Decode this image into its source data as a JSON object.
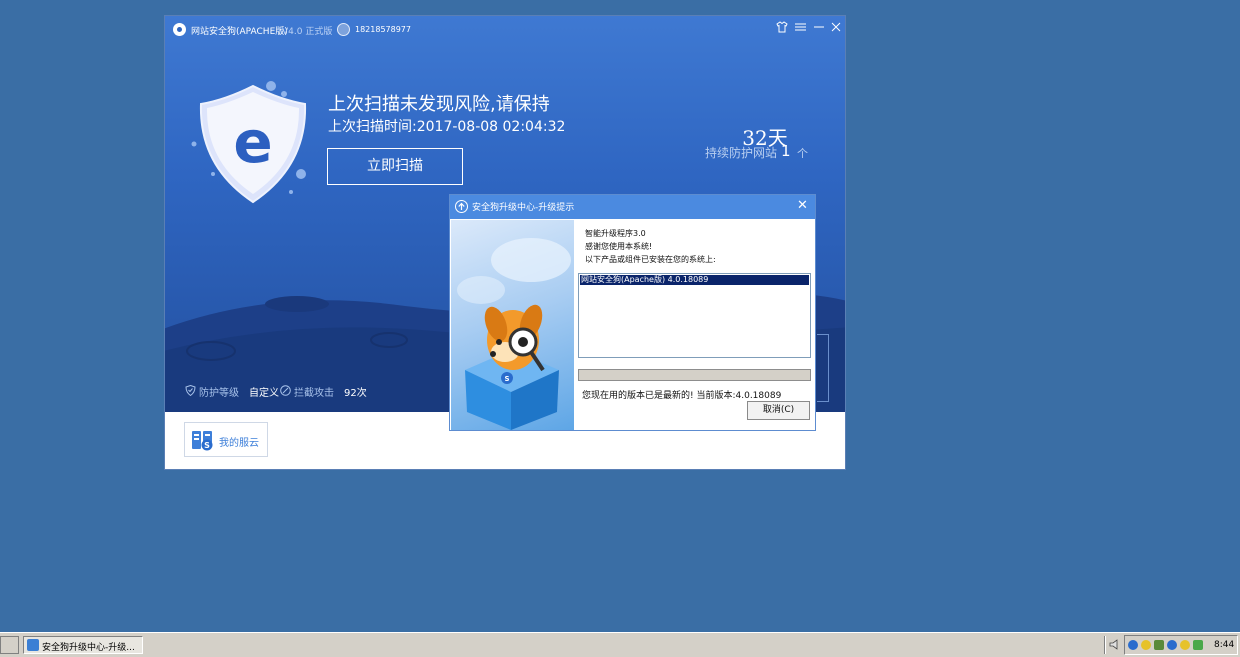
{
  "main_window": {
    "app_name": "网站安全狗(APACHE版)",
    "version": "V4.0 正式版",
    "user_phone": "18218578977",
    "controls": {
      "skin": "skin-icon",
      "menu": "menu-icon",
      "minimize": "minimize-icon",
      "close": "close-icon"
    },
    "headline": "上次扫描未发现风险,请保持",
    "last_scan": "上次扫描时间:2017-08-08 02:04:32",
    "scan_button": "立即扫描",
    "days": "32天",
    "protect_label": "持续防护网站",
    "protect_count": "1",
    "protect_unit": "个",
    "protect_level_label": "防护等级",
    "protect_level_value": "自定义",
    "blocked_label": "拦截攻击",
    "blocked_value": "92次",
    "service_button": "我的服云"
  },
  "dialog": {
    "title": "安全狗升级中心-升级提示",
    "line1": "智能升级程序3.0",
    "line2": "感谢您使用本系统!",
    "line3": "以下产品或组件已安装在您的系统上:",
    "products": [
      "网站安全狗(Apache版) 4.0.18089"
    ],
    "status": "您现在用的版本已是最新的! 当前版本:4.0.18089",
    "cancel": "取消(C)"
  },
  "taskbar": {
    "task_label": "安全狗升级中心-升级...",
    "clock": "8:44"
  },
  "colors": {
    "desktop": "#3a6ea5",
    "accent": "#2f66c2",
    "dialog_title": "#4b8ae0"
  }
}
